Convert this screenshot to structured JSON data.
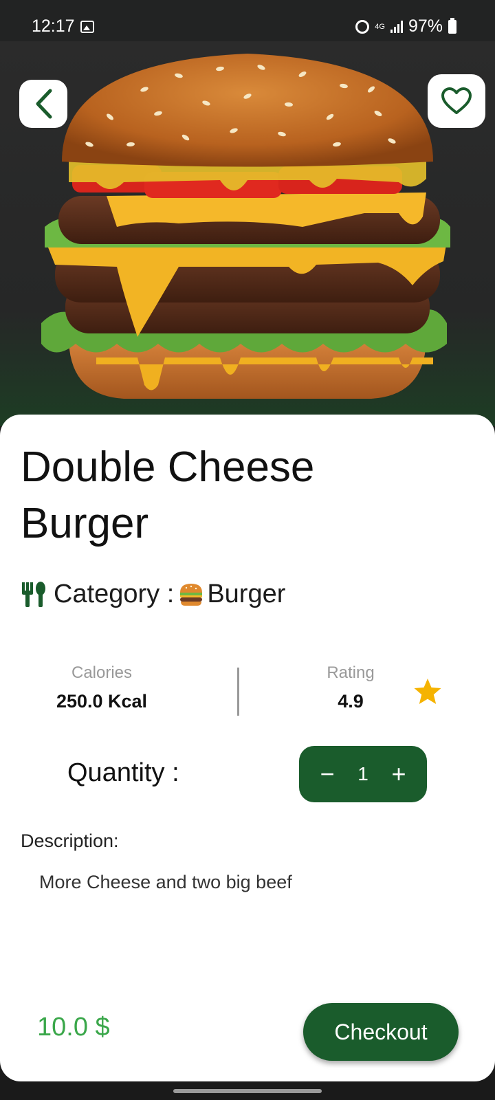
{
  "status_bar": {
    "time": "12:17",
    "network": "4G",
    "battery": "97%"
  },
  "product": {
    "title": "Double Cheese Burger",
    "category_label": "Category :",
    "category_value": "Burger",
    "calories_label": "Calories",
    "calories_value": "250.0 Kcal",
    "rating_label": "Rating",
    "rating_value": "4.9",
    "quantity_label": "Quantity :",
    "quantity": "1",
    "description_label": "Description:",
    "description": "More Cheese and two big beef",
    "price": "10.0 $"
  },
  "actions": {
    "decrement": "−",
    "increment": "+",
    "checkout": "Checkout"
  },
  "colors": {
    "accent": "#1a5c2c",
    "price": "#3aa74a",
    "star": "#f5b301"
  },
  "icons": [
    "back-icon",
    "heart-icon",
    "cutlery-icon",
    "burger-emoji-icon",
    "star-icon"
  ]
}
